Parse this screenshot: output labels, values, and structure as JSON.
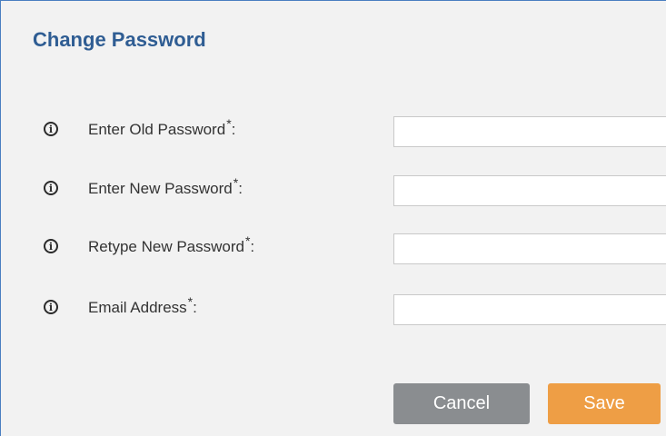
{
  "dialog": {
    "title": "Change Password"
  },
  "form": {
    "fields": [
      {
        "label": "Enter Old Password",
        "required_mark": "*",
        "suffix": ":",
        "value": "",
        "type": "password"
      },
      {
        "label": "Enter New Password",
        "required_mark": "*",
        "suffix": ":",
        "value": "",
        "type": "password"
      },
      {
        "label": "Retype New Password",
        "required_mark": "*",
        "suffix": ":",
        "value": "",
        "type": "password"
      },
      {
        "label": "Email Address",
        "required_mark": "*",
        "suffix": ":",
        "value": "",
        "type": "text"
      }
    ],
    "info_icon_glyph": "i",
    "info_icon_name": "info-icon"
  },
  "buttons": {
    "cancel_label": "Cancel",
    "save_label": "Save"
  },
  "colors": {
    "title": "#2f5d93",
    "border_accent": "#4a7fc1",
    "cancel_bg": "#8a8d90",
    "save_bg": "#ee9e45",
    "panel_bg": "#f2f2f2"
  }
}
